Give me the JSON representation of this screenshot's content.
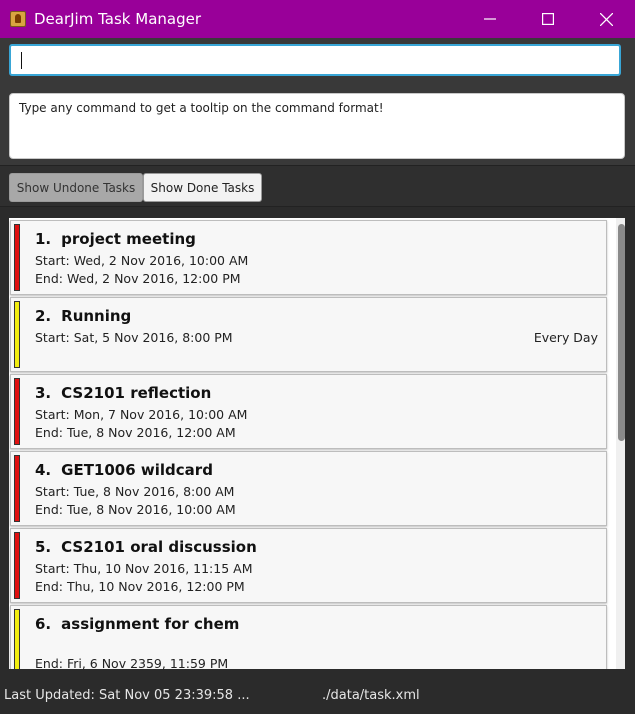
{
  "window": {
    "title": "DearJim Task Manager",
    "icon": "app-icon",
    "controls": [
      "minimize-icon",
      "maximize-icon",
      "close-icon"
    ]
  },
  "command": {
    "input_value": "",
    "result_text": "Type any command to get a tooltip on the command format!"
  },
  "tabs": {
    "undone": "Show Undone Tasks",
    "done": "Show Done Tasks"
  },
  "priority_colors": {
    "high": "#e01010",
    "medium": "#f2ee10"
  },
  "tasks": [
    {
      "index": "1.",
      "name": "project meeting",
      "priority": "high",
      "line1": "Start: Wed, 2 Nov 2016, 10:00 AM",
      "line2": "End: Wed, 2 Nov 2016, 12:00 PM",
      "recurrence": ""
    },
    {
      "index": "2.",
      "name": "Running",
      "priority": "medium",
      "line1": "Start: Sat, 5 Nov 2016, 8:00 PM",
      "line2": "",
      "recurrence": "Every Day"
    },
    {
      "index": "3.",
      "name": "CS2101 reflection",
      "priority": "high",
      "line1": "Start: Mon, 7 Nov 2016, 10:00 AM",
      "line2": "End: Tue, 8 Nov 2016, 12:00 AM",
      "recurrence": ""
    },
    {
      "index": "4.",
      "name": "GET1006 wildcard",
      "priority": "high",
      "line1": "Start: Tue, 8 Nov 2016, 8:00 AM",
      "line2": "End: Tue, 8 Nov 2016, 10:00 AM",
      "recurrence": ""
    },
    {
      "index": "5.",
      "name": "CS2101 oral discussion",
      "priority": "high",
      "line1": "Start: Thu, 10 Nov 2016, 11:15 AM",
      "line2": "End: Thu, 10 Nov 2016, 12:00 PM",
      "recurrence": ""
    },
    {
      "index": "6.",
      "name": "assignment for chem",
      "priority": "medium",
      "line1": "",
      "line2": "End: Fri, 6 Nov 2359, 11:59 PM",
      "recurrence": ""
    }
  ],
  "status": {
    "last_updated": "Last Updated: Sat Nov 05 23:39:58 ...",
    "file_path": "./data/task.xml"
  }
}
